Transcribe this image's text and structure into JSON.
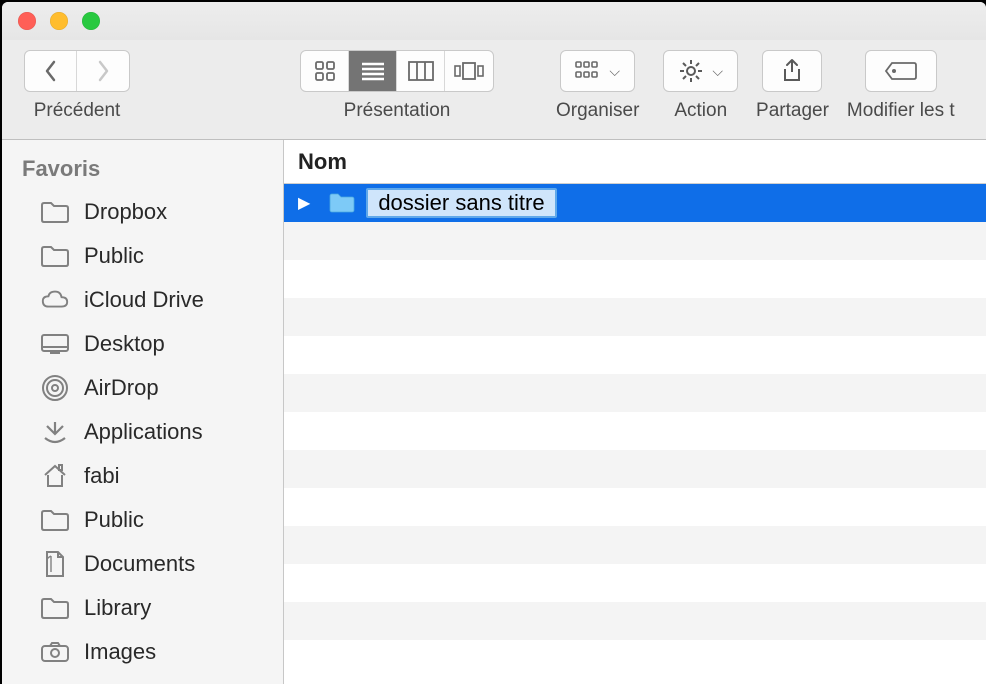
{
  "toolbar": {
    "back_forward_label": "Précédent",
    "view_label": "Présentation",
    "arrange_label": "Organiser",
    "action_label": "Action",
    "share_label": "Partager",
    "tags_label": "Modifier les t"
  },
  "sidebar": {
    "heading": "Favoris",
    "items": [
      {
        "icon": "folder",
        "label": "Dropbox"
      },
      {
        "icon": "folder",
        "label": "Public"
      },
      {
        "icon": "cloud",
        "label": "iCloud Drive"
      },
      {
        "icon": "desktop",
        "label": "Desktop"
      },
      {
        "icon": "airdrop",
        "label": "AirDrop"
      },
      {
        "icon": "apps",
        "label": "Applications"
      },
      {
        "icon": "home",
        "label": "fabi"
      },
      {
        "icon": "folder",
        "label": "Public"
      },
      {
        "icon": "document",
        "label": "Documents"
      },
      {
        "icon": "folder",
        "label": "Library"
      },
      {
        "icon": "camera",
        "label": "Images"
      }
    ]
  },
  "content": {
    "column_header": "Nom",
    "selected_folder_name": "dossier sans titre"
  },
  "colors": {
    "selection": "#0f6ee8",
    "rename_bg": "#cfe5fb",
    "rename_border": "#5fa8ea"
  }
}
